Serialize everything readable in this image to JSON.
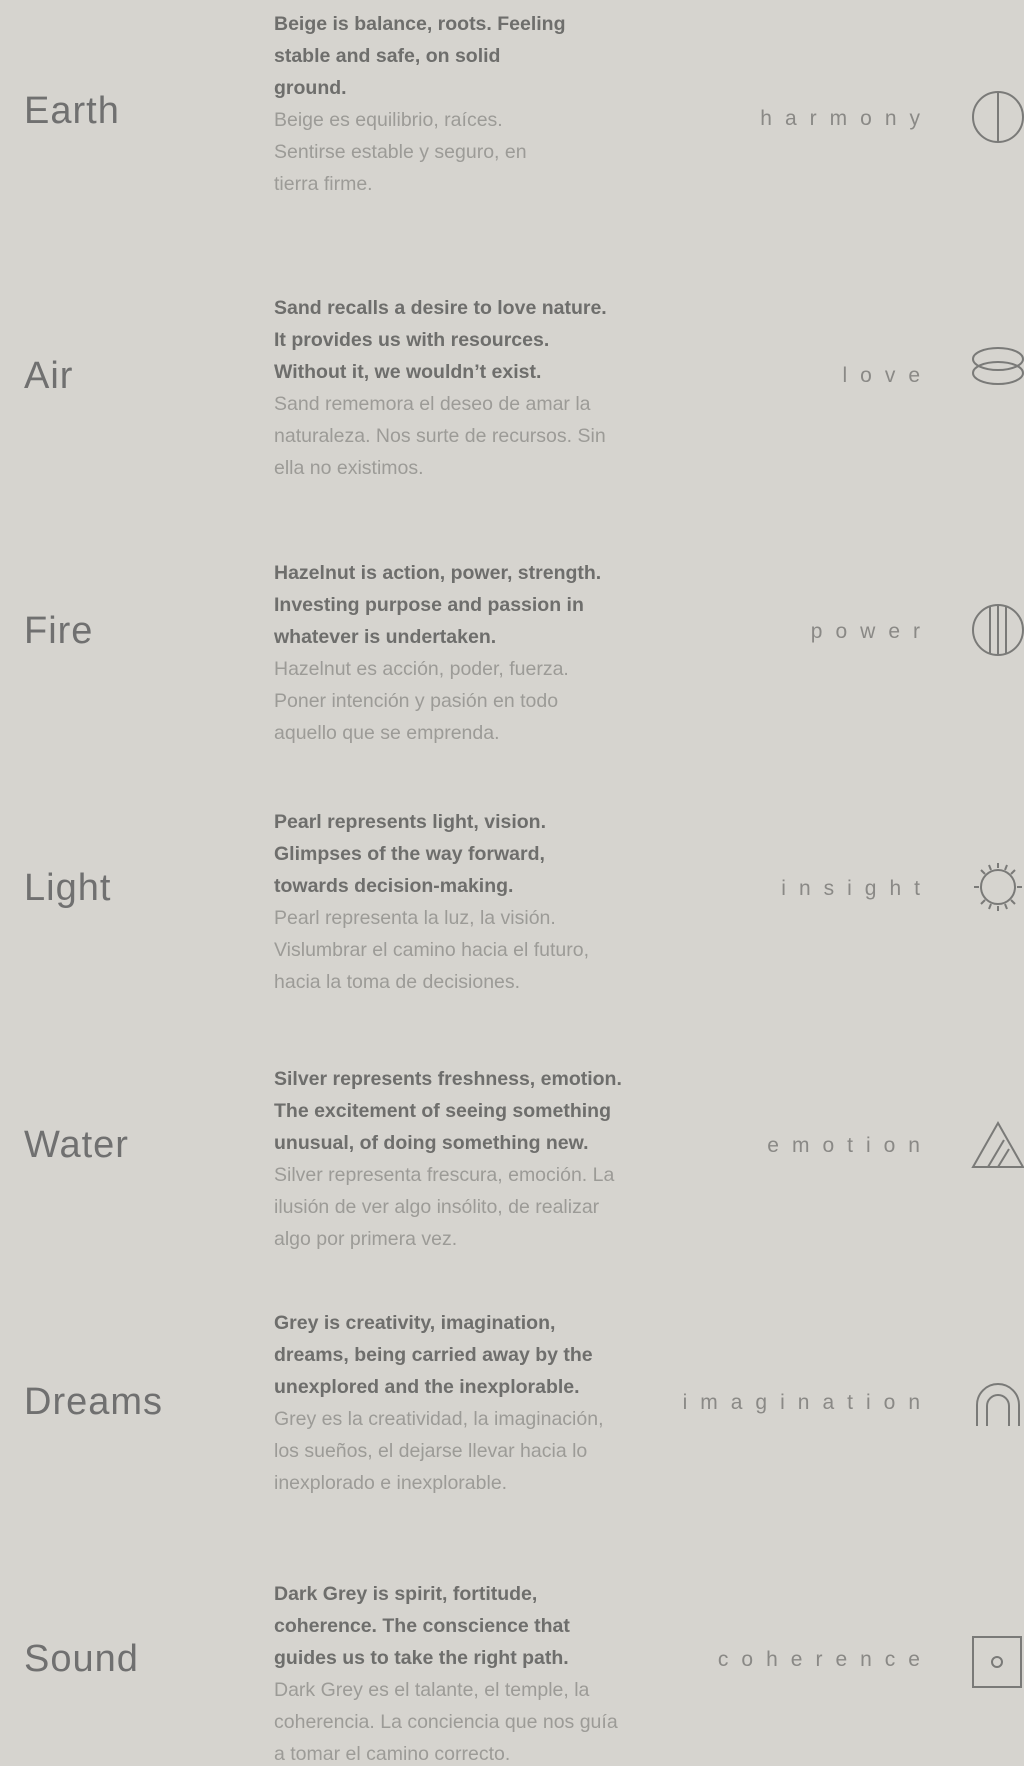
{
  "rows": [
    {
      "name": "Earth",
      "en": "Beige is balance, roots. Feeling stable and safe, on solid ground.",
      "es": "Beige es equilibrio, raíces. Sentirse estable y seguro, en tierra firme.",
      "keyword": "harmony",
      "icon": "circle-vertical-line-icon"
    },
    {
      "name": "Air",
      "en": "Sand recalls a desire to love nature. It provides us with resources. Without it, we wouldn’t exist.",
      "es": "Sand rememora el deseo de amar la naturaleza. Nos surte de recursos. Sin ella no existimos.",
      "keyword": "love",
      "icon": "ellipse-stack-icon"
    },
    {
      "name": "Fire",
      "en": "Hazelnut is action, power, strength. Investing purpose and passion in whatever is undertaken.",
      "es": "Hazelnut es acción, poder, fuerza. Poner intención y pasión en todo aquello que se emprenda.",
      "keyword": "power",
      "icon": "circle-three-lines-icon"
    },
    {
      "name": "Light",
      "en": "Pearl represents light, vision. Glimpses of the way forward, towards decision-making.",
      "es": "Pearl representa la luz, la visión. Vislumbrar el camino hacia el futuro, hacia la toma de decisiones.",
      "keyword": "insight",
      "icon": "sun-icon"
    },
    {
      "name": "Water",
      "en": "Silver represents freshness, emotion. The excitement of seeing something unusual, of doing something new.",
      "es": "Silver representa frescura, emoción. La ilusión de ver algo insólito, de realizar algo por primera vez.",
      "keyword": "emotion",
      "icon": "triangle-lines-icon"
    },
    {
      "name": "Dreams",
      "en": "Grey is creativity, imagination, dreams, being carried away by the unexplored and the inexplorable.",
      "es": "Grey es la creatividad, la imaginación, los sueños, el dejarse llevar hacia lo inexplorado e inexplorable.",
      "keyword": "imagination",
      "icon": "arch-icon"
    },
    {
      "name": "Sound",
      "en": "Dark Grey is spirit, fortitude, coherence. The conscience that guides us to take the right path.",
      "es": "Dark Grey es el talante, el temple, la coherencia. La conciencia que nos guía a tomar el camino correcto.",
      "keyword": "coherence",
      "icon": "square-dot-icon"
    }
  ],
  "colors": {
    "background": "#d6d4cf",
    "title": "#707070",
    "english": "#6e6e6c",
    "spanish": "#9c9b97",
    "keyword": "#8a8986",
    "icon": "#7a7a78"
  }
}
